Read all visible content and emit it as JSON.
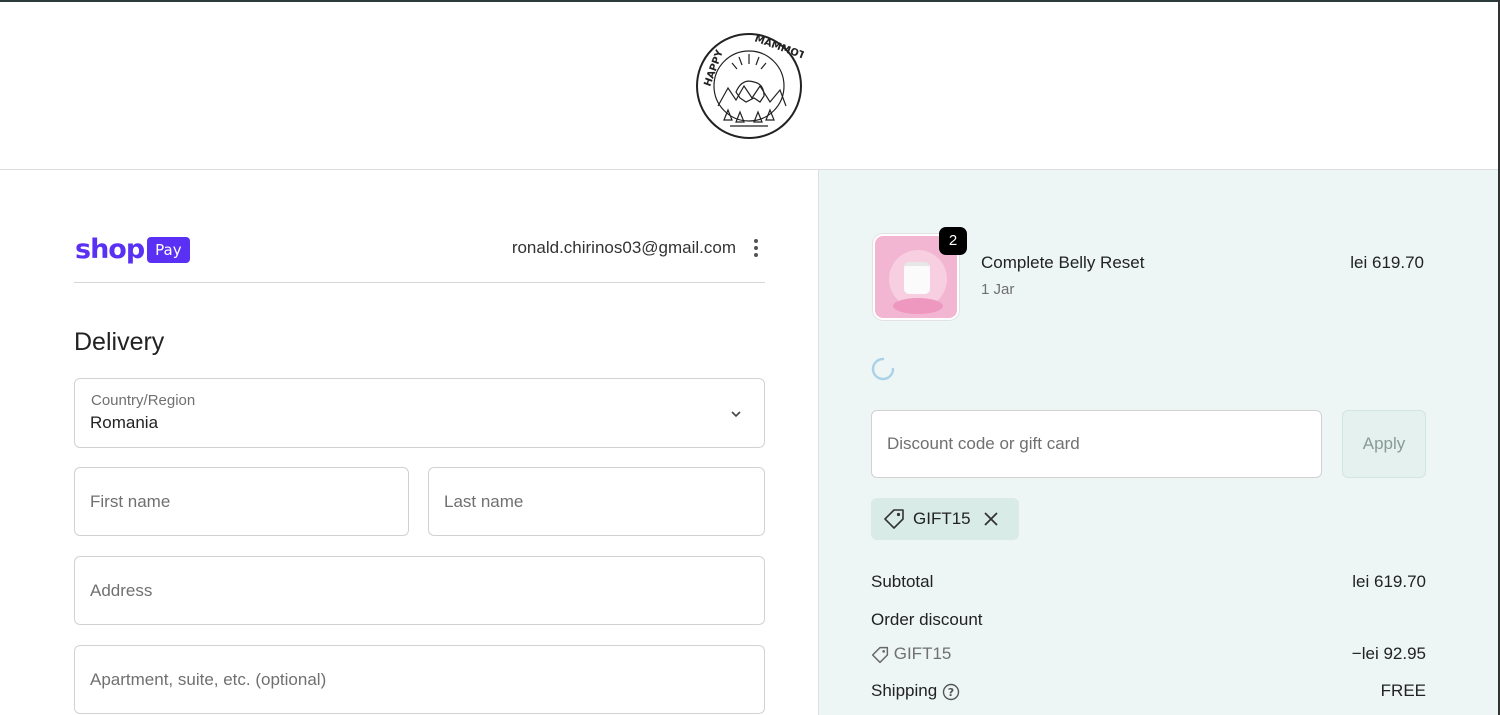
{
  "brand": {
    "name": "HAPPY MAMMOTH"
  },
  "account": {
    "shop_label": "shop",
    "pay_label": "Pay",
    "email": "ronald.chirinos03@gmail.com"
  },
  "delivery": {
    "heading": "Delivery",
    "country": {
      "label": "Country/Region",
      "value": "Romania"
    },
    "first_name": {
      "placeholder": "First name"
    },
    "last_name": {
      "placeholder": "Last name"
    },
    "address": {
      "placeholder": "Address"
    },
    "apartment": {
      "placeholder": "Apartment, suite, etc. (optional)"
    }
  },
  "cart": {
    "items": [
      {
        "name": "Complete Belly Reset",
        "variant": "1 Jar",
        "price": "lei 619.70",
        "quantity": "2"
      }
    ]
  },
  "discount": {
    "placeholder": "Discount code or gift card",
    "apply_label": "Apply",
    "applied_code": "GIFT15"
  },
  "summary": {
    "subtotal_label": "Subtotal",
    "subtotal_value": "lei 619.70",
    "order_discount_label": "Order discount",
    "discount_code": "GIFT15",
    "discount_value": "−lei 92.95",
    "shipping_label": "Shipping",
    "shipping_value": "FREE"
  },
  "colors": {
    "shop_pay_purple": "#5a31f4",
    "summary_background": "#edf5f5",
    "chip_background": "#d8ebe6"
  }
}
